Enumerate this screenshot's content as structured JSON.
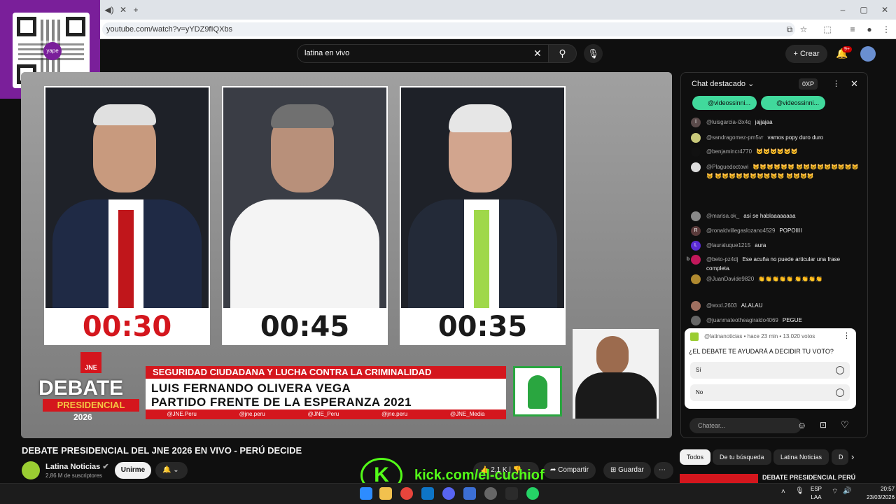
{
  "browser": {
    "url": "youtube.com/watch?v=yYDZ9fIQXbs"
  },
  "header": {
    "search_value": "latina en vivo",
    "create_label": "Crear",
    "notif_badge": "9+"
  },
  "video": {
    "timers": [
      "00:30",
      "00:45",
      "00:35"
    ],
    "lower_third_topic": "SEGURIDAD CIUDADANA Y LUCHA CONTRA LA CRIMINALIDAD",
    "lower_third_name": "LUIS FERNANDO OLIVERA VEGA",
    "lower_third_party": "PARTIDO FRENTE DE LA ESPERANZA 2021",
    "debate_word": "DEBATE",
    "debate_sub": "PRESIDENCIAL",
    "debate_year": "2026",
    "jne": "JNE",
    "social": [
      "@JNE.Peru",
      "@jne.peru",
      "@JNE_Peru",
      "@jne.peru",
      "@JNE_Media"
    ]
  },
  "qr": {
    "label": "yape"
  },
  "meta": {
    "title": "DEBATE PRESIDENCIAL DEL JNE 2026 EN VIVO - PERÚ DECIDE",
    "channel": "Latina Noticias",
    "subscribers": "2,86 M de suscriptores",
    "join_label": "Unirme",
    "likes": "2,1 K",
    "share_label": "Compartir",
    "save_label": "Guardar",
    "kick_text": "kick.com/el-cuchiof"
  },
  "chat": {
    "title": "Chat destacado",
    "xp": "0XP",
    "pinned": [
      "@videossinni...",
      "@videossinni..."
    ],
    "messages": [
      {
        "author": "@luisgarcia-i3x4q",
        "text": "jajjajaa",
        "avatar": "l",
        "color": "#5a4a4a"
      },
      {
        "author": "@sandragomez-pm5vr",
        "text": "vamos popy duro duro",
        "avatar": "",
        "color": "#c9c97a"
      },
      {
        "author": "@benjamincr4770",
        "text": "😺😺😺😺😺😺",
        "avatar": "",
        "color": "#111111"
      },
      {
        "author": "@Plaguedoctowi",
        "text": "😺😺😺😺😺😺 😺😺😺😺😺😺😺😺😺😺 😺😺😺😺😺😺😺😺😺😺 😺😺😺😺",
        "avatar": "",
        "color": "#dddddd"
      },
      {
        "author": "@marisa.ok_",
        "text": "así se hablaaaaaaaa",
        "avatar": "",
        "color": "#888888"
      },
      {
        "author": "@ronaldvillegaslozano4529",
        "text": "POPOIIII",
        "avatar": "R",
        "color": "#5a3a3a"
      },
      {
        "author": "@lauraluque1215",
        "text": "aura",
        "avatar": "L",
        "color": "#5b2bd6"
      },
      {
        "author": "@beto-pz4dj",
        "text": "Ese acuña no puede articular una frase completa.",
        "avatar": "b",
        "color": "#c2185b"
      },
      {
        "author": "@JuanDavide9820",
        "text": "👏👏👏👏👏 👏👏👏👏",
        "avatar": "",
        "color": "#b08a30"
      },
      {
        "author": "@wxxl.2603",
        "text": "ALALAU",
        "avatar": "",
        "color": "#a07060"
      },
      {
        "author": "@juanmateotheagiraldo4069",
        "text": "PEGUE",
        "avatar": "",
        "color": "#666666"
      }
    ],
    "poll": {
      "author": "@latinanoticias",
      "meta": "hace 23 min • 13.020 votos",
      "question": "¿EL DEBATE TE AYUDARÁ A DECIDIR TU VOTO?",
      "options": [
        "Sí",
        "No"
      ]
    },
    "input_placeholder": "Chatear..."
  },
  "side_tabs": [
    "Todos",
    "De tu búsqueda",
    "Latina Noticias",
    "D"
  ],
  "side_video_title": "DEBATE PRESIDENCIAL PERÚ",
  "taskbar": {
    "lang1": "ESP",
    "lang2": "LAA",
    "time": "20:57",
    "date": "23/03/2026"
  }
}
